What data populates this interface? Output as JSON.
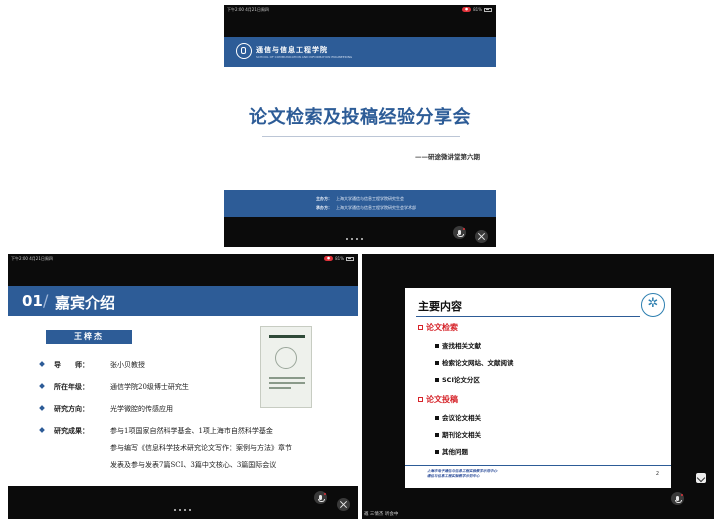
{
  "panel1": {
    "status": {
      "time": "下午2:00  4月21日周四",
      "rec": "●  ",
      "battery": "81%"
    },
    "slide": {
      "school_name": "通信与信息工程学院",
      "school_name_en": "SCHOOL OF COMMUNICATION AND INFORMATION ENGINEERING",
      "title": "论文检索及投稿经验分享会",
      "subtitle": "——研途微讲堂第六期",
      "organizer_label": "主办方：",
      "organizer": "上海大学通信与信息工程学院研究生会",
      "host_label": "承办方：",
      "host": "上海大学通信与信息工程学院研究生会学术部"
    }
  },
  "panel2": {
    "status": {
      "time": "下午2:00  4月21日周四",
      "battery": "81%"
    },
    "slide": {
      "section_num": "01",
      "section_title": "嘉宾介绍",
      "guest_name": "王梓杰",
      "rows": [
        {
          "label": "导　　师：",
          "value": "张小贝教授"
        },
        {
          "label": "所在年级：",
          "value": "通信学院20级博士研究生"
        },
        {
          "label": "研究方向：",
          "value": "光学微腔的传感应用"
        },
        {
          "label": "研究成果：",
          "value": "参与1项国家自然科学基金、1项上海市自然科学基金"
        }
      ],
      "result_more": [
        "参与编写《信息科学技术研究论文写作：案例与方法》章节",
        "发表及参与发表7篇SCI、3篇中文核心、3篇国际会议"
      ]
    }
  },
  "panel3": {
    "slide": {
      "title": "主要内容",
      "section1": "论文检索",
      "items1": [
        "查找相关文献",
        "检索论文网站、文献阅读",
        "SCI论文分区"
      ],
      "section2": "论文投稿",
      "items2": [
        "会议论文相关",
        "期刊论文相关",
        "其他问题"
      ],
      "footer_line1": "上海市电子通信与信息工程实验教学示范中心·",
      "footer_line2": "通信与信息工程实验教学示范中心",
      "page_number": "2"
    },
    "status_text": "邀 三情杰 听会中"
  },
  "icons": {
    "mic": "mic-icon",
    "expand": "expand-icon"
  }
}
